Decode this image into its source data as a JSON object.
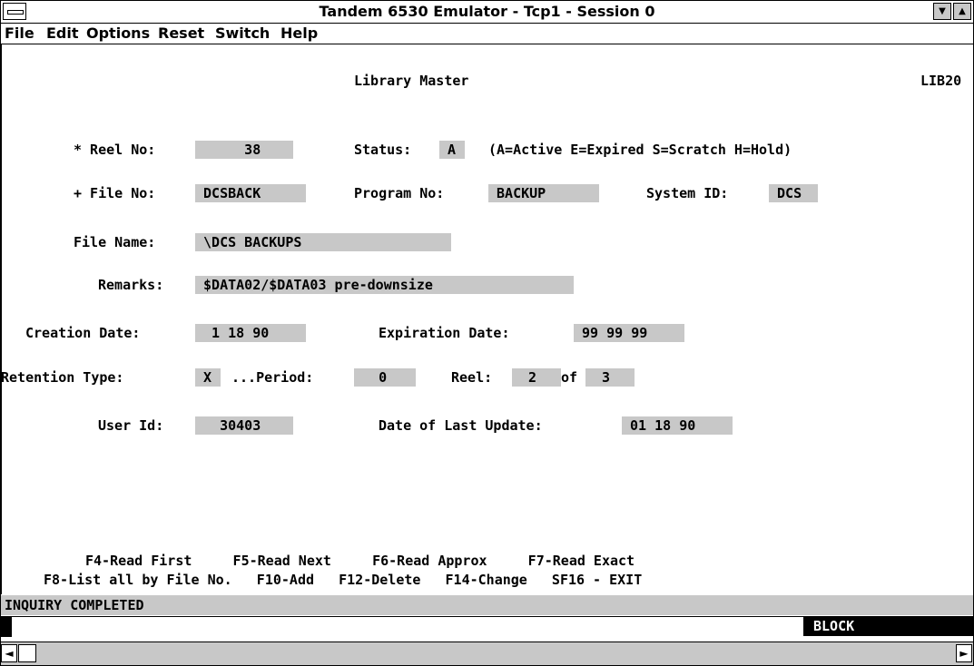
{
  "window": {
    "title": "Tandem 6530 Emulator - Tcp1 - Session 0",
    "min_glyph": "▼",
    "max_glyph": "▲"
  },
  "menu": [
    "File",
    "Edit",
    "Options",
    "Reset",
    "Switch",
    "Help"
  ],
  "screen": {
    "heading": "Library Master",
    "screen_id": "LIB20",
    "reel_no_label": "* Reel No:",
    "reel_no_value": "      38",
    "status_label": "Status:",
    "status_value": " A",
    "status_legend": "(A=Active E=Expired S=Scratch H=Hold)",
    "file_no_label": "+ File No:",
    "file_no_value": " DCSBACK",
    "program_no_label": "Program No:",
    "program_no_value": " BACKUP",
    "system_id_label": "System ID:",
    "system_id_value": " DCS",
    "file_name_label": "File Name:",
    "file_name_value": " \\DCS BACKUPS",
    "remarks_label": "Remarks:",
    "remarks_value": " $DATA02/$DATA03 pre-downsize",
    "creation_date_label": "Creation Date:",
    "creation_date_value": "  1 18 90",
    "expiration_date_label": "Expiration Date:",
    "expiration_date_value": " 99 99 99",
    "retention_type_label": "Retention Type:",
    "retention_type_value": " X",
    "period_label": "...Period:",
    "period_value": "   0",
    "reel_label": "Reel:",
    "reel_value": "  2",
    "of_label": "of",
    "reel_of_value": "  3",
    "user_id_label": "User Id:",
    "user_id_value": "   30403",
    "last_update_label": "Date of Last Update:",
    "last_update_value": " 01 18 90",
    "fkeys_line1": "F4-Read First     F5-Read Next     F6-Read Approx     F7-Read Exact",
    "fkeys_line2": "F8-List all by File No.   F10-Add   F12-Delete   F14-Change   SF16 - EXIT"
  },
  "status_message": "INQUIRY COMPLETED",
  "block_indicator": "BLOCK",
  "scroll": {
    "left_glyph": "◄",
    "right_glyph": "►"
  },
  "colors": {
    "field_bg": "#c8c8c8",
    "indicator_bg": "#000000"
  }
}
